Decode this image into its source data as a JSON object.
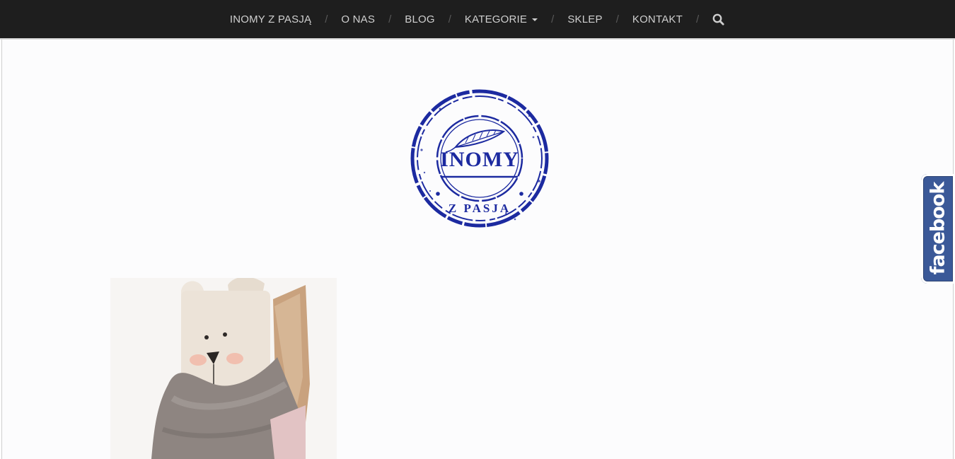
{
  "nav": {
    "items": [
      {
        "label": "INOMY Z PASJĄ"
      },
      {
        "label": "O NAS"
      },
      {
        "label": "BLOG"
      },
      {
        "label": "KATEGORIE",
        "has_dropdown": true
      },
      {
        "label": "SKLEP"
      },
      {
        "label": "KONTAKT"
      }
    ],
    "separator": "/",
    "search_icon": "search-icon"
  },
  "logo": {
    "main_text": "INOMY",
    "sub_text": "Z PASJĄ",
    "color": "#1c2aa0",
    "icon": "feather-icon"
  },
  "social": {
    "facebook_label": "facebook",
    "facebook_color": "#3b5998"
  },
  "colors": {
    "nav_background": "#1e1e1e",
    "nav_text": "#cfcfcf",
    "page_background": "#fcfcfd"
  }
}
